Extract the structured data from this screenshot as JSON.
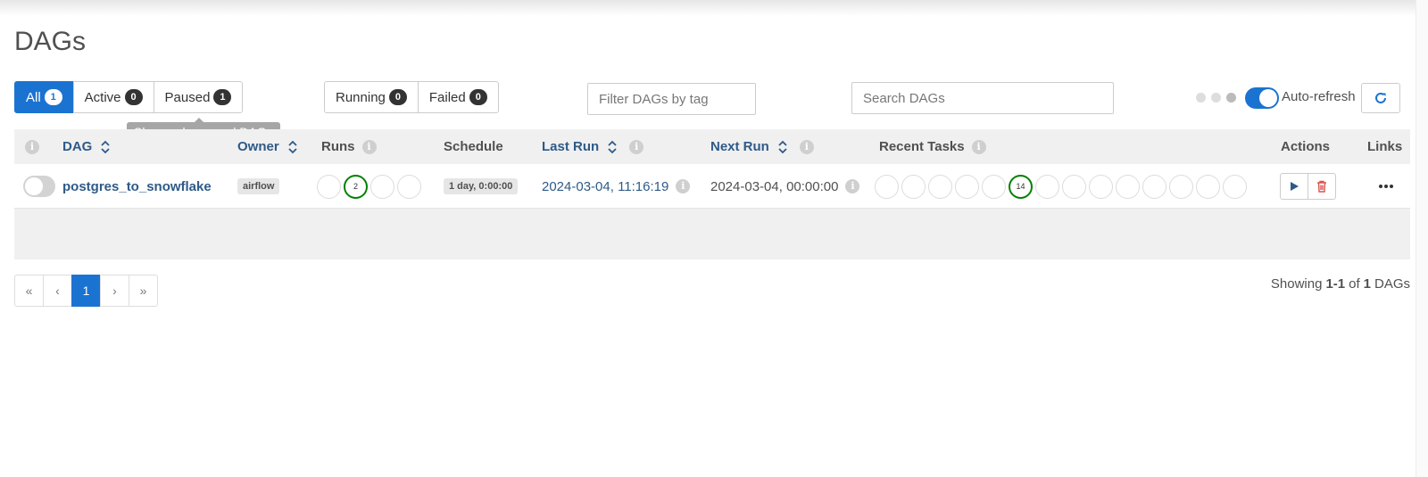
{
  "page": {
    "title": "DAGs"
  },
  "status_filters": [
    {
      "label": "All",
      "count": "1",
      "active": true
    },
    {
      "label": "Active",
      "count": "0"
    },
    {
      "label": "Paused",
      "count": "1"
    }
  ],
  "tooltip": "Show only paused DAGs",
  "run_filters": [
    {
      "label": "Running",
      "count": "0"
    },
    {
      "label": "Failed",
      "count": "0"
    }
  ],
  "tag_filter": {
    "placeholder": "Filter DAGs by tag"
  },
  "search": {
    "placeholder": "Search DAGs"
  },
  "auto_refresh": {
    "label": "Auto-refresh",
    "enabled": true
  },
  "table": {
    "headers": {
      "dag": "DAG",
      "owner": "Owner",
      "runs": "Runs",
      "schedule": "Schedule",
      "last_run": "Last Run",
      "next_run": "Next Run",
      "recent_tasks": "Recent Tasks",
      "actions": "Actions",
      "links": "Links"
    },
    "rows": [
      {
        "dag_id": "postgres_to_snowflake",
        "paused": true,
        "owner": "airflow",
        "runs_success": "2",
        "schedule": "1 day, 0:00:00",
        "last_run": "2024-03-04, 11:16:19",
        "next_run": "2024-03-04, 00:00:00",
        "recent_tasks_success": "14"
      }
    ]
  },
  "pagination": {
    "first": "«",
    "prev": "‹",
    "current": "1",
    "next": "›",
    "last": "»"
  },
  "showing": {
    "prefix": "Showing",
    "range": "1-1",
    "of": "of",
    "total": "1",
    "suffix": "DAGs"
  },
  "colors": {
    "primary": "#1b73d1",
    "link": "#2e5a88",
    "success": "#008000",
    "danger": "#d9534f"
  }
}
